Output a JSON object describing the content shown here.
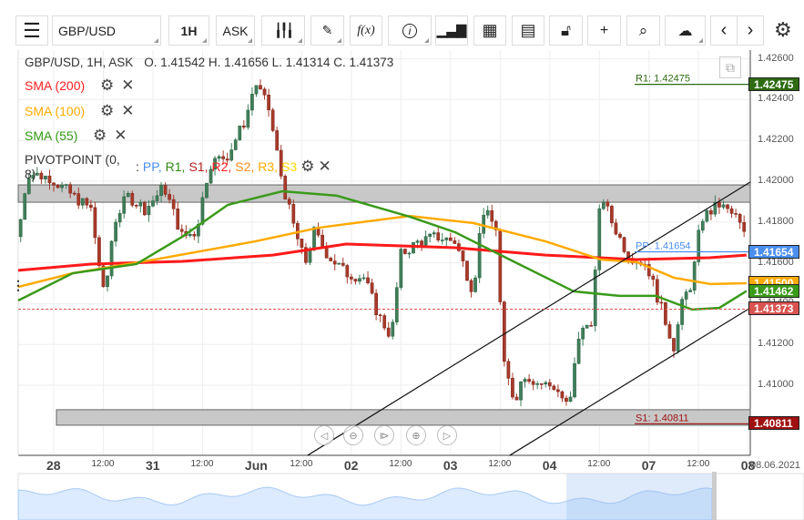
{
  "toolbar": {
    "symbol": "GBP/USD",
    "timeframe": "1H",
    "price_side": "ASK",
    "fx_label": "f(x)",
    "info_label": "i"
  },
  "legend": {
    "title": "GBP/USD, 1H, ASK",
    "ohlc": "O. 1.41542 H. 1.41656 L. 1.41314 C. 1.41373",
    "indicators": [
      {
        "label": "SMA (200)",
        "color": "#ff2020"
      },
      {
        "label": "SMA (100)",
        "color": "#ffaa00"
      },
      {
        "label": "SMA (55)",
        "color": "#2e9a12"
      }
    ],
    "pivot": {
      "label": "PIVOTPOINT (0, 8)",
      "sep": ":",
      "parts": [
        {
          "t": "PP,",
          "c": "#4a8ef0"
        },
        {
          "t": "R1,",
          "c": "#2e8a12"
        },
        {
          "t": "S1,",
          "c": "#b52020"
        },
        {
          "t": "R2,",
          "c": "#ff2020"
        },
        {
          "t": "S2,",
          "c": "#ff8c1a"
        },
        {
          "t": "R3,",
          "c": "#ffaa00"
        },
        {
          "t": "S3",
          "c": "#ffd700"
        }
      ]
    }
  },
  "chart_data": {
    "type": "candlestick",
    "y_ticks": [
      "1.42600",
      "1.42400",
      "1.42200",
      "1.42000",
      "1.41800",
      "1.41600",
      "1.41400",
      "1.41200",
      "1.41000"
    ],
    "x_ticks": [
      {
        "label": "28",
        "major": true,
        "h": 0
      },
      {
        "label": "12:00",
        "h": 12
      },
      {
        "label": "31",
        "major": true,
        "h": 24
      },
      {
        "label": "12:00",
        "h": 36
      },
      {
        "label": "Jun",
        "major": true,
        "h": 48
      },
      {
        "label": "12:00",
        "h": 60
      },
      {
        "label": "02",
        "major": true,
        "h": 72
      },
      {
        "label": "12:00",
        "h": 84
      },
      {
        "label": "03",
        "major": true,
        "h": 96
      },
      {
        "label": "12:00",
        "h": 108
      },
      {
        "label": "04",
        "major": true,
        "h": 120
      },
      {
        "label": "12:00",
        "h": 132
      },
      {
        "label": "07",
        "major": true,
        "h": 144
      },
      {
        "label": "12:00",
        "h": 156
      },
      {
        "label": "08",
        "major": true,
        "h": 168
      }
    ],
    "date_label": "08.06.2021",
    "price_path": [
      [
        -8.6,
        1.41728
      ],
      [
        -6.4,
        1.4204
      ],
      [
        -0.9,
        1.42018
      ],
      [
        4.6,
        1.41929
      ],
      [
        9,
        1.41862
      ],
      [
        12.3,
        1.41415
      ],
      [
        14.5,
        1.41795
      ],
      [
        17.8,
        1.41929
      ],
      [
        22.2,
        1.41862
      ],
      [
        26.7,
        1.41973
      ],
      [
        31.1,
        1.41728
      ],
      [
        34.4,
        1.4175
      ],
      [
        37.7,
        1.42085
      ],
      [
        42.1,
        1.42129
      ],
      [
        46.5,
        1.42308
      ],
      [
        48.7,
        1.42487
      ],
      [
        52,
        1.42353
      ],
      [
        55.3,
        1.41996
      ],
      [
        57.5,
        1.41817
      ],
      [
        60.8,
        1.41594
      ],
      [
        63,
        1.4175
      ],
      [
        66.3,
        1.41638
      ],
      [
        70.7,
        1.41549
      ],
      [
        75.1,
        1.41527
      ],
      [
        78.4,
        1.41348
      ],
      [
        81.7,
        1.41237
      ],
      [
        83.9,
        1.41638
      ],
      [
        88.3,
        1.41705
      ],
      [
        92.7,
        1.41728
      ],
      [
        97.1,
        1.41705
      ],
      [
        101.5,
        1.4146
      ],
      [
        103.7,
        1.41862
      ],
      [
        107,
        1.41772
      ],
      [
        108.8,
        1.41103
      ],
      [
        111.5,
        1.40924
      ],
      [
        113.7,
        1.41058
      ],
      [
        117,
        1.41013
      ],
      [
        121.4,
        1.40991
      ],
      [
        124.7,
        1.4088
      ],
      [
        126.9,
        1.41237
      ],
      [
        130.2,
        1.41326
      ],
      [
        132.4,
        1.41951
      ],
      [
        134.6,
        1.41817
      ],
      [
        139,
        1.41638
      ],
      [
        143.4,
        1.41594
      ],
      [
        145.6,
        1.4146
      ],
      [
        150,
        1.41192
      ],
      [
        152.2,
        1.41415
      ],
      [
        154.4,
        1.41504
      ],
      [
        156.6,
        1.41817
      ],
      [
        161,
        1.41884
      ],
      [
        165.4,
        1.41817
      ],
      [
        167.6,
        1.41706
      ]
    ],
    "sma200": [
      [
        -8.6,
        1.41563
      ],
      [
        9,
        1.41594
      ],
      [
        31.1,
        1.41607
      ],
      [
        53,
        1.41638
      ],
      [
        70.7,
        1.41692
      ],
      [
        97.1,
        1.41674
      ],
      [
        119,
        1.41638
      ],
      [
        141,
        1.41616
      ],
      [
        158.6,
        1.41625
      ],
      [
        167.6,
        1.41638
      ]
    ],
    "sma100": [
      [
        -8.6,
        1.41482
      ],
      [
        4.6,
        1.41549
      ],
      [
        24.4,
        1.41616
      ],
      [
        48.7,
        1.41705
      ],
      [
        64.1,
        1.41772
      ],
      [
        86.1,
        1.4183
      ],
      [
        101.5,
        1.41795
      ],
      [
        119,
        1.41705
      ],
      [
        132.4,
        1.41616
      ],
      [
        141.2,
        1.41603
      ],
      [
        150,
        1.41527
      ],
      [
        158.8,
        1.41496
      ],
      [
        167.6,
        1.415
      ]
    ],
    "sma55": [
      [
        -8.6,
        1.41415
      ],
      [
        4.6,
        1.41549
      ],
      [
        20,
        1.41594
      ],
      [
        31.1,
        1.41728
      ],
      [
        42.1,
        1.41884
      ],
      [
        55.3,
        1.41951
      ],
      [
        68.5,
        1.41929
      ],
      [
        86.1,
        1.41826
      ],
      [
        97.1,
        1.4175
      ],
      [
        110.3,
        1.41616
      ],
      [
        125.8,
        1.4146
      ],
      [
        136.8,
        1.41438
      ],
      [
        145.6,
        1.41438
      ],
      [
        154.4,
        1.41371
      ],
      [
        161,
        1.41379
      ],
      [
        167.6,
        1.41462
      ]
    ],
    "zones": [
      [
        1.41982,
        1.41897
      ],
      [
        1.4088,
        1.40804
      ]
    ],
    "trendlines": [
      [
        [
          61.4,
          1.40656
        ],
        [
          168.5,
          1.41996
        ]
      ],
      [
        [
          110.3,
          1.40656
        ],
        [
          168.5,
          1.41379
        ]
      ]
    ],
    "pivots": [
      {
        "label": "R1: 1.42475",
        "value": 1.42475,
        "tag": "1.42475",
        "color": "#2e6b12"
      },
      {
        "label": "PP: 1.41654",
        "value": 1.41654,
        "tag": "1.41654",
        "color": "#4a8ef0"
      },
      {
        "label": "S1: 1.40811",
        "value": 1.40811,
        "tag": "1.40811",
        "color": "#a01010"
      }
    ],
    "tags": [
      {
        "text": "1.41500",
        "color": "#ffaa00",
        "value": 1.415
      },
      {
        "text": "1.41462",
        "color": "#3a9a1a",
        "value": 1.41462
      },
      {
        "text": "1.41373",
        "color": "#d9534f",
        "value": 1.41373
      }
    ],
    "close": 1.41373
  }
}
